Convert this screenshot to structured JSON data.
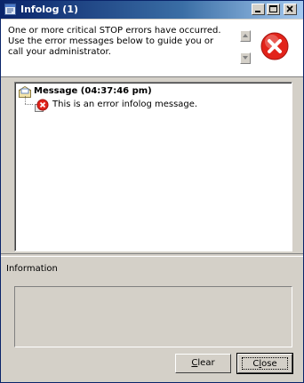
{
  "window": {
    "title": "Infolog (1)",
    "title_icon": "infolog-icon"
  },
  "header": {
    "message": "One or more critical STOP errors have occurred. Use the error messages below to guide you or call your administrator.",
    "icon": "error-icon"
  },
  "tree": {
    "root": {
      "label": "Message (04:37:46 pm)",
      "icon": "message-icon"
    },
    "child": {
      "label": "This is an error infolog message.",
      "icon": "error-message-icon"
    }
  },
  "info": {
    "label": "Information"
  },
  "buttons": {
    "clear": {
      "prefix": "",
      "mnemonic": "C",
      "rest": "lear"
    },
    "close": {
      "prefix": "C",
      "mnemonic": "l",
      "rest": "ose"
    }
  },
  "colors": {
    "titlebar": "#0a246a",
    "error_red": "#e2231a",
    "face": "#d4d0c8"
  }
}
